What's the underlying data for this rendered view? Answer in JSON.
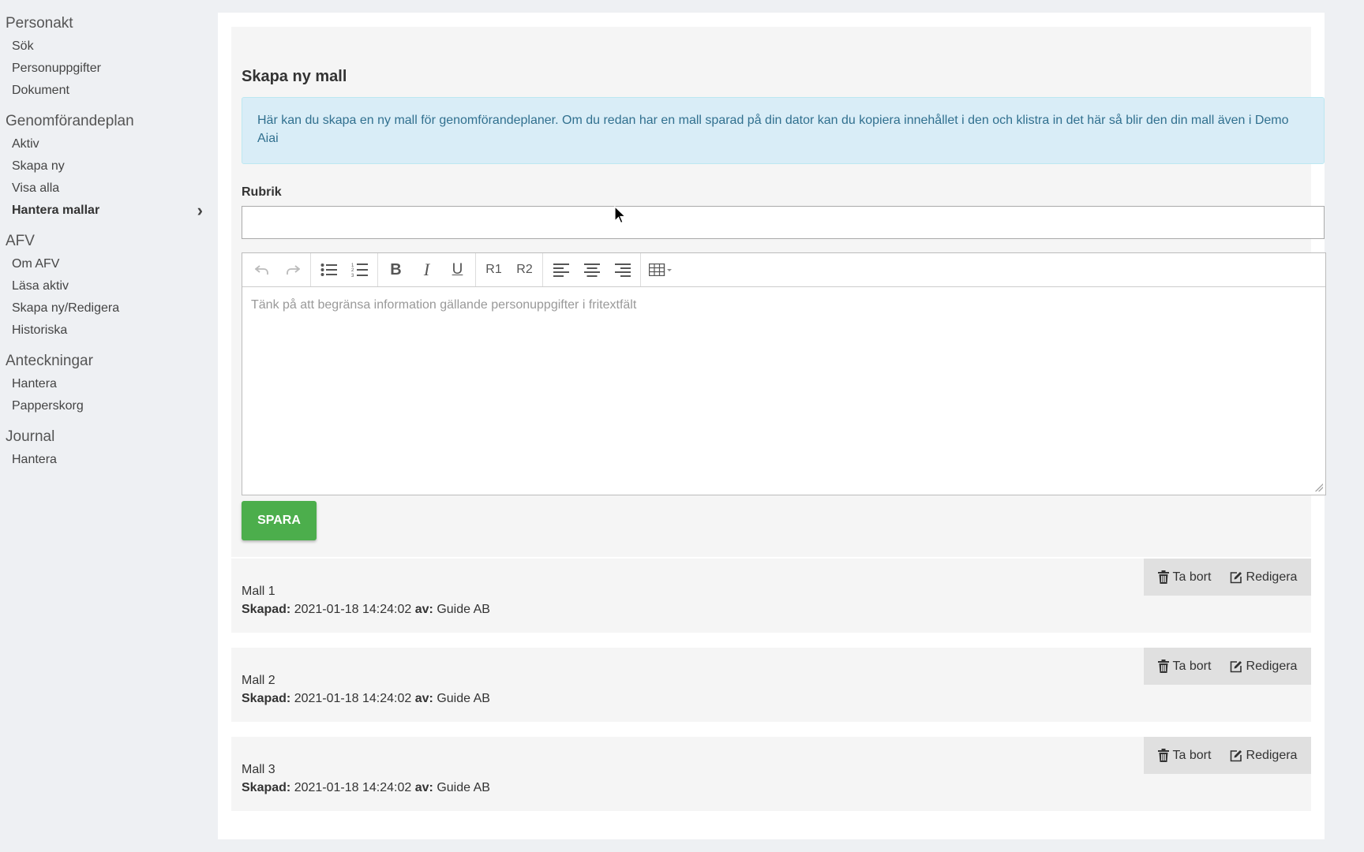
{
  "sidebar": {
    "sections": [
      {
        "heading": "Personakt",
        "items": [
          {
            "label": "Sök"
          },
          {
            "label": "Personuppgifter"
          },
          {
            "label": "Dokument"
          }
        ]
      },
      {
        "heading": "Genomförandeplan",
        "items": [
          {
            "label": "Aktiv"
          },
          {
            "label": "Skapa ny"
          },
          {
            "label": "Visa alla"
          },
          {
            "label": "Hantera mallar",
            "active": true
          }
        ]
      },
      {
        "heading": "AFV",
        "items": [
          {
            "label": "Om AFV"
          },
          {
            "label": "Läsa aktiv"
          },
          {
            "label": "Skapa ny/Redigera"
          },
          {
            "label": "Historiska"
          }
        ]
      },
      {
        "heading": "Anteckningar",
        "items": [
          {
            "label": "Hantera"
          },
          {
            "label": "Papperskorg"
          }
        ]
      },
      {
        "heading": "Journal",
        "items": [
          {
            "label": "Hantera"
          }
        ]
      }
    ]
  },
  "form": {
    "title": "Skapa ny mall",
    "info": "Här kan du skapa en ny mall för genomförandeplaner. Om du redan har en mall sparad på din dator kan du kopiera innehållet i den och klistra in det här så blir den din mall även i Demo Aiai",
    "rubrik_label": "Rubrik",
    "rubrik_value": "",
    "editor_placeholder": "Tänk på att begränsa information gällande personuppgifter i fritextfält",
    "toolbar": {
      "bold": "B",
      "italic": "I",
      "underline": "U",
      "r1": "R1",
      "r2": "R2"
    },
    "save_label": "SPARA"
  },
  "templates": [
    {
      "name": "Mall 1",
      "created_label": "Skapad:",
      "created": "2021-01-18 14:24:02",
      "by_label": "av:",
      "by": "Guide AB",
      "delete_label": "Ta bort",
      "edit_label": "Redigera"
    },
    {
      "name": "Mall 2",
      "created_label": "Skapad:",
      "created": "2021-01-18 14:24:02",
      "by_label": "av:",
      "by": "Guide AB",
      "delete_label": "Ta bort",
      "edit_label": "Redigera"
    },
    {
      "name": "Mall 3",
      "created_label": "Skapad:",
      "created": "2021-01-18 14:24:02",
      "by_label": "av:",
      "by": "Guide AB",
      "delete_label": "Ta bort",
      "edit_label": "Redigera"
    }
  ],
  "colors": {
    "info_bg": "#d9edf7",
    "info_text": "#31708f",
    "save_button": "#4cae4c",
    "action_bg": "#e0e0e0"
  }
}
